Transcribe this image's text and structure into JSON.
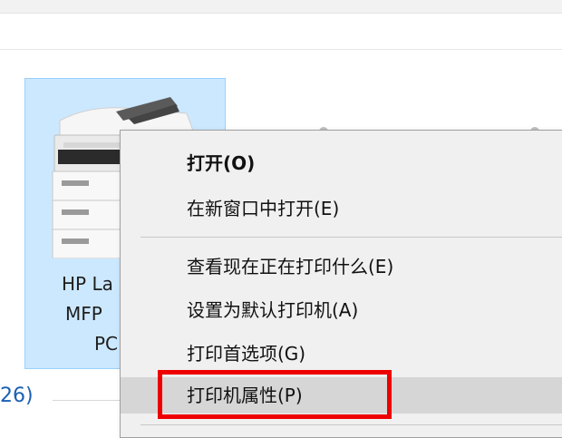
{
  "printer": {
    "name_line1": "HP La",
    "name_line2": "MFP",
    "name_line3": "PC"
  },
  "section": {
    "count_text": "26)"
  },
  "context_menu": {
    "items": [
      {
        "label": "打开(O)",
        "bold": true
      },
      {
        "label": "在新窗口中打开(E)"
      },
      {
        "label": "查看现在正在打印什么(E)"
      },
      {
        "label": "设置为默认打印机(A)"
      },
      {
        "label": "打印首选项(G)"
      },
      {
        "label": "打印机属性(P)",
        "hovered": true
      }
    ]
  },
  "colors": {
    "selection_bg": "#cce8ff",
    "selection_border": "#99d1ff",
    "menu_bg": "#f0f0f0",
    "menu_hover": "#d6d6d6",
    "annotation_red": "#ee0000"
  }
}
